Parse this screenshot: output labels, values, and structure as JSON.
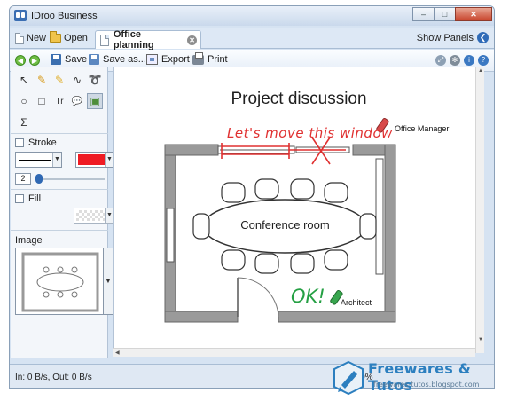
{
  "window": {
    "title": "IDroo Business"
  },
  "window_buttons": {
    "minimize": "–",
    "maximize": "□",
    "close": "✕"
  },
  "tabbar": {
    "new_label": "New",
    "open_label": "Open",
    "document_tab": "Office planning",
    "show_panels_label": "Show Panels"
  },
  "toolbar": {
    "save_label": "Save",
    "save_as_label": "Save as...",
    "export_label": "Export",
    "print_label": "Print"
  },
  "tools": {
    "pointer": "↖",
    "pencil": "✎",
    "highlighter": "✎",
    "connector": "∿",
    "spiral": "➰",
    "ellipse": "○",
    "rectangle": "□",
    "text": "Tr",
    "callout": "💬",
    "image": "▣",
    "formula": "Σ"
  },
  "stroke": {
    "label": "Stroke",
    "width_value": "2",
    "color": "#ef1b23"
  },
  "fill": {
    "label": "Fill"
  },
  "image": {
    "label": "Image"
  },
  "canvas": {
    "title": "Project discussion",
    "room_label": "Conference room",
    "note_red": "Let's move this window",
    "note_green": "OK!",
    "role_manager": "Office Manager",
    "role_architect": "Architect"
  },
  "status": {
    "transfer": "In: 0 B/s, Out: 0 B/s",
    "zoom": "100%"
  },
  "watermark": {
    "title": "Freewares & Tutos",
    "url": "freewares-tutos.blogspot.com"
  },
  "colors": {
    "accent": "#2f6bb8",
    "annotation_red": "#e03030",
    "annotation_green": "#25a044",
    "wall": "#9a9a9a"
  }
}
